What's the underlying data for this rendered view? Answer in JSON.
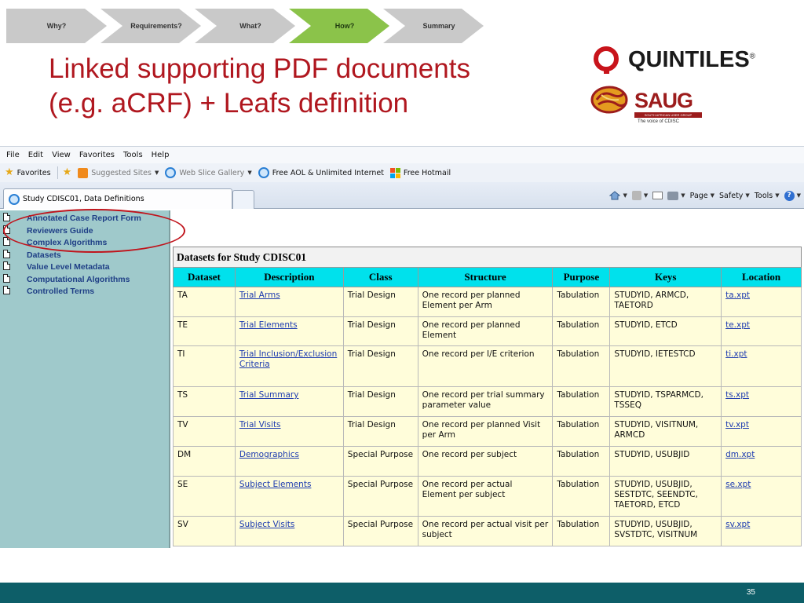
{
  "process_steps": [
    {
      "label": "Why?",
      "active": false
    },
    {
      "label": "Requirements?",
      "active": false
    },
    {
      "label": "What?",
      "active": false
    },
    {
      "label": "How?",
      "active": true
    },
    {
      "label": "Summary",
      "active": false
    }
  ],
  "title_line1": "Linked supporting PDF documents",
  "title_line2": "(e.g. aCRF) + Leafs definition",
  "logos": {
    "quintiles": "QUINTILES",
    "quintiles_mark": "®",
    "saug": "SAUG",
    "saug_sub": "SOUTH AFRICAN USER GROUP",
    "saug_tagline": "The voice of CDISC"
  },
  "browser": {
    "menu": [
      "File",
      "Edit",
      "View",
      "Favorites",
      "Tools",
      "Help"
    ],
    "favorites": {
      "favorites_label": "Favorites",
      "suggested_sites": "Suggested Sites",
      "web_slice_gallery": "Web Slice Gallery",
      "aol": "Free AOL & Unlimited Internet",
      "hotmail": "Free Hotmail"
    },
    "tab_title": "Study CDISC01, Data Definitions",
    "commands": {
      "page": "Page",
      "safety": "Safety",
      "tools": "Tools"
    }
  },
  "nav_items": [
    "Annotated Case Report Form",
    "Reviewers Guide",
    "Complex Algorithms",
    "Datasets",
    "Value Level Metadata",
    "Computational Algorithms",
    "Controlled Terms"
  ],
  "datasets_title": "Datasets for Study CDISC01",
  "table": {
    "headers": [
      "Dataset",
      "Description",
      "Class",
      "Structure",
      "Purpose",
      "Keys",
      "Location"
    ],
    "rows": [
      {
        "dataset": "TA",
        "description": "Trial Arms",
        "class": "Trial Design",
        "structure": "One record per planned Element per Arm",
        "purpose": "Tabulation",
        "keys": "STUDYID, ARMCD, TAETORD",
        "location": "ta.xpt"
      },
      {
        "dataset": "TE",
        "description": "Trial Elements",
        "class": "Trial Design",
        "structure": "One record per planned Element",
        "purpose": "Tabulation",
        "keys": "STUDYID, ETCD",
        "location": "te.xpt"
      },
      {
        "dataset": "TI",
        "description": "Trial Inclusion/Exclusion Criteria",
        "class": "Trial Design",
        "structure": "One record per I/E criterion",
        "purpose": "Tabulation",
        "keys": "STUDYID, IETESTCD",
        "location": "ti.xpt"
      },
      {
        "dataset": "TS",
        "description": "Trial Summary",
        "class": "Trial Design",
        "structure": "One record per trial summary parameter value",
        "purpose": "Tabulation",
        "keys": "STUDYID, TSPARMCD, TSSEQ",
        "location": "ts.xpt"
      },
      {
        "dataset": "TV",
        "description": "Trial Visits",
        "class": "Trial Design",
        "structure": "One record per planned Visit per Arm",
        "purpose": "Tabulation",
        "keys": "STUDYID, VISITNUM, ARMCD",
        "location": "tv.xpt"
      },
      {
        "dataset": "DM",
        "description": "Demographics",
        "class": "Special Purpose",
        "structure": "One record per subject",
        "purpose": "Tabulation",
        "keys": "STUDYID, USUBJID",
        "location": "dm.xpt"
      },
      {
        "dataset": "SE",
        "description": "Subject Elements",
        "class": "Special Purpose",
        "structure": "One record per actual Element per subject",
        "purpose": "Tabulation",
        "keys": "STUDYID, USUBJID, SESTDTC, SEENDTC, TAETORD, ETCD",
        "location": "se.xpt"
      },
      {
        "dataset": "SV",
        "description": "Subject Visits",
        "class": "Special Purpose",
        "structure": "One record per actual visit per subject",
        "purpose": "Tabulation",
        "keys": "STUDYID, USUBJID, SVSTDTC, VISITNUM",
        "location": "sv.xpt"
      }
    ]
  },
  "page_number": "35",
  "colors": {
    "title": "#b0171f",
    "active_step": "#8bc34a",
    "inactive_step": "#c9c9c9",
    "left_pane": "#9fc9cb",
    "table_header": "#00e1ec",
    "table_cell": "#fffdda",
    "footer": "#0d5e68",
    "highlight_circle": "#c0141c"
  }
}
